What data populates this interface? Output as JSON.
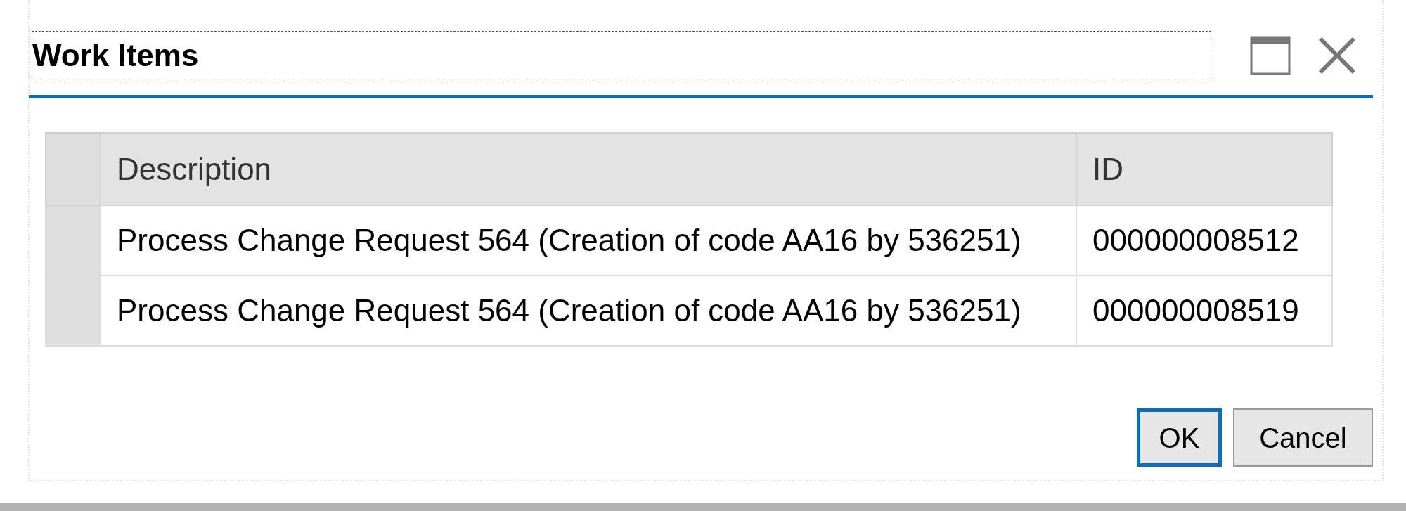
{
  "window": {
    "title": "Work Items"
  },
  "table": {
    "columns": [
      "Description",
      "ID"
    ],
    "rows": [
      {
        "cells": [
          "Process Change Request 564 (Creation of code AA16 by 536251)",
          "000000008512"
        ]
      },
      {
        "cells": [
          "Process Change Request 564 (Creation of code AA16 by 536251)",
          "000000008519"
        ]
      }
    ]
  },
  "buttons": [
    {
      "label": "OK",
      "focused": true
    },
    {
      "label": "Cancel",
      "focused": false
    }
  ]
}
